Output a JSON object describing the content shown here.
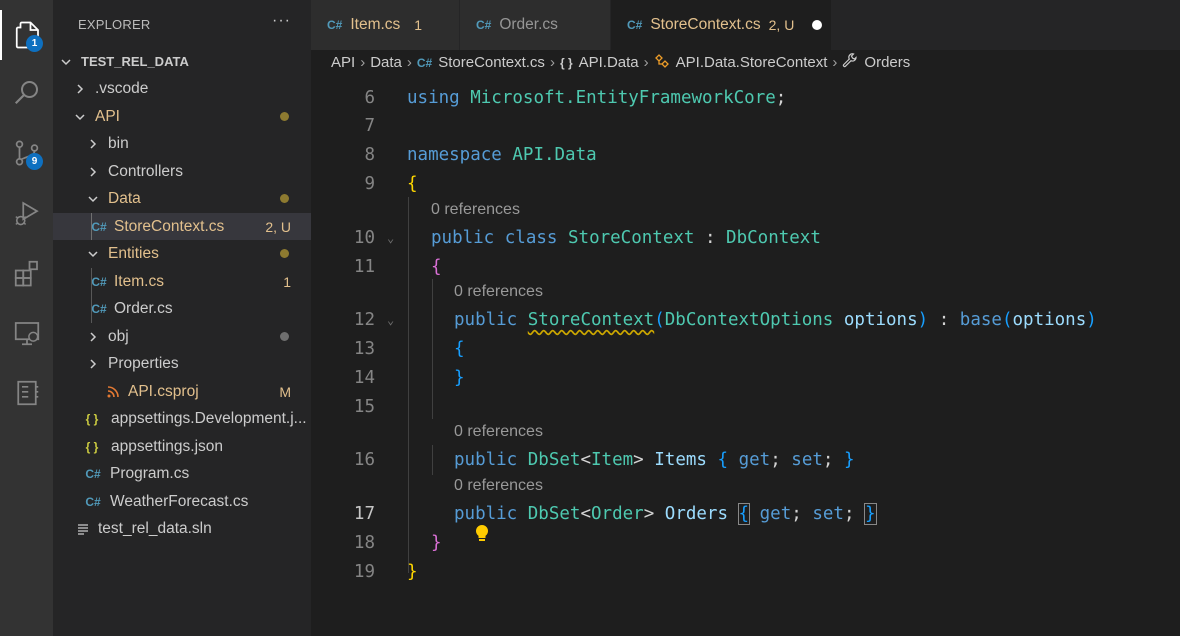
{
  "activity_bar": {
    "explorer_badge": "1",
    "scm_badge": "9"
  },
  "sidebar": {
    "title": "EXPLORER",
    "more": "···",
    "root": "TEST_REL_DATA",
    "items": [
      {
        "label": ".vscode"
      },
      {
        "label": "API"
      },
      {
        "label": "bin"
      },
      {
        "label": "Controllers"
      },
      {
        "label": "Data"
      },
      {
        "label": "StoreContext.cs",
        "status": "2, U"
      },
      {
        "label": "Entities"
      },
      {
        "label": "Item.cs",
        "status": "1"
      },
      {
        "label": "Order.cs"
      },
      {
        "label": "obj"
      },
      {
        "label": "Properties"
      },
      {
        "label": "API.csproj",
        "status": "M"
      },
      {
        "label": "appsettings.Development.j..."
      },
      {
        "label": "appsettings.json"
      },
      {
        "label": "Program.cs"
      },
      {
        "label": "WeatherForecast.cs"
      },
      {
        "label": "test_rel_data.sln"
      }
    ]
  },
  "tabs": [
    {
      "label": "Item.cs",
      "status": "1"
    },
    {
      "label": "Order.cs"
    },
    {
      "label": "StoreContext.cs",
      "status": "2, U"
    }
  ],
  "breadcrumb": [
    "API",
    "Data",
    "StoreContext.cs",
    "API.Data",
    "API.Data.StoreContext",
    "Orders"
  ],
  "icons": {
    "csharp": "C#",
    "json": "{ }",
    "namespace": "{ }"
  },
  "editor": {
    "line_numbers": [
      "6",
      "7",
      "8",
      "9",
      "10",
      "11",
      "12",
      "13",
      "14",
      "15",
      "16",
      "17",
      "18",
      "19"
    ],
    "code": {
      "l6_kw": "using",
      "l6_ns": "Microsoft.EntityFrameworkCore",
      "l6_semi": ";",
      "l8_kw": "namespace",
      "l8_ns": "API.Data",
      "l9_brace": "{",
      "lens_a": "0 references",
      "l10_kw1": "public",
      "l10_kw2": "class",
      "l10_type": "StoreContext",
      "l10_colon": " : ",
      "l10_base": "DbContext",
      "l11_brace": "{",
      "lens_b": "0 references",
      "l12_kw": "public",
      "l12_ctor": "StoreContext",
      "l12_paren_open": "(",
      "l12_ptype": "DbContextOptions",
      "l12_pname": "options",
      "l12_paren_close": ")",
      "l12_colon": " : ",
      "l12_base": "base",
      "l12_paren2_open": "(",
      "l12_arg": "options",
      "l12_paren2_close": ")",
      "l13_brace": "{",
      "l14_brace": "}",
      "lens_c": "0 references",
      "l16_kw": "public",
      "l16_type": "DbSet",
      "l16_lt": "<",
      "l16_targ": "Item",
      "l16_gt": ">",
      "l16_prop": "Items",
      "l16_open": "{",
      "l16_get": "get",
      "l16_semi1": ";",
      "l16_set": "set",
      "l16_semi2": ";",
      "l16_close": "}",
      "lens_d": "0 references",
      "l17_kw": "public",
      "l17_type": "DbSet",
      "l17_lt": "<",
      "l17_targ": "Order",
      "l17_gt": ">",
      "l17_prop": "Orders",
      "l17_open": "{",
      "l17_get": "get",
      "l17_semi1": ";",
      "l17_set": "set",
      "l17_semi2": ";",
      "l17_close": "}",
      "l18_brace": "}",
      "l19_brace": "}"
    }
  }
}
